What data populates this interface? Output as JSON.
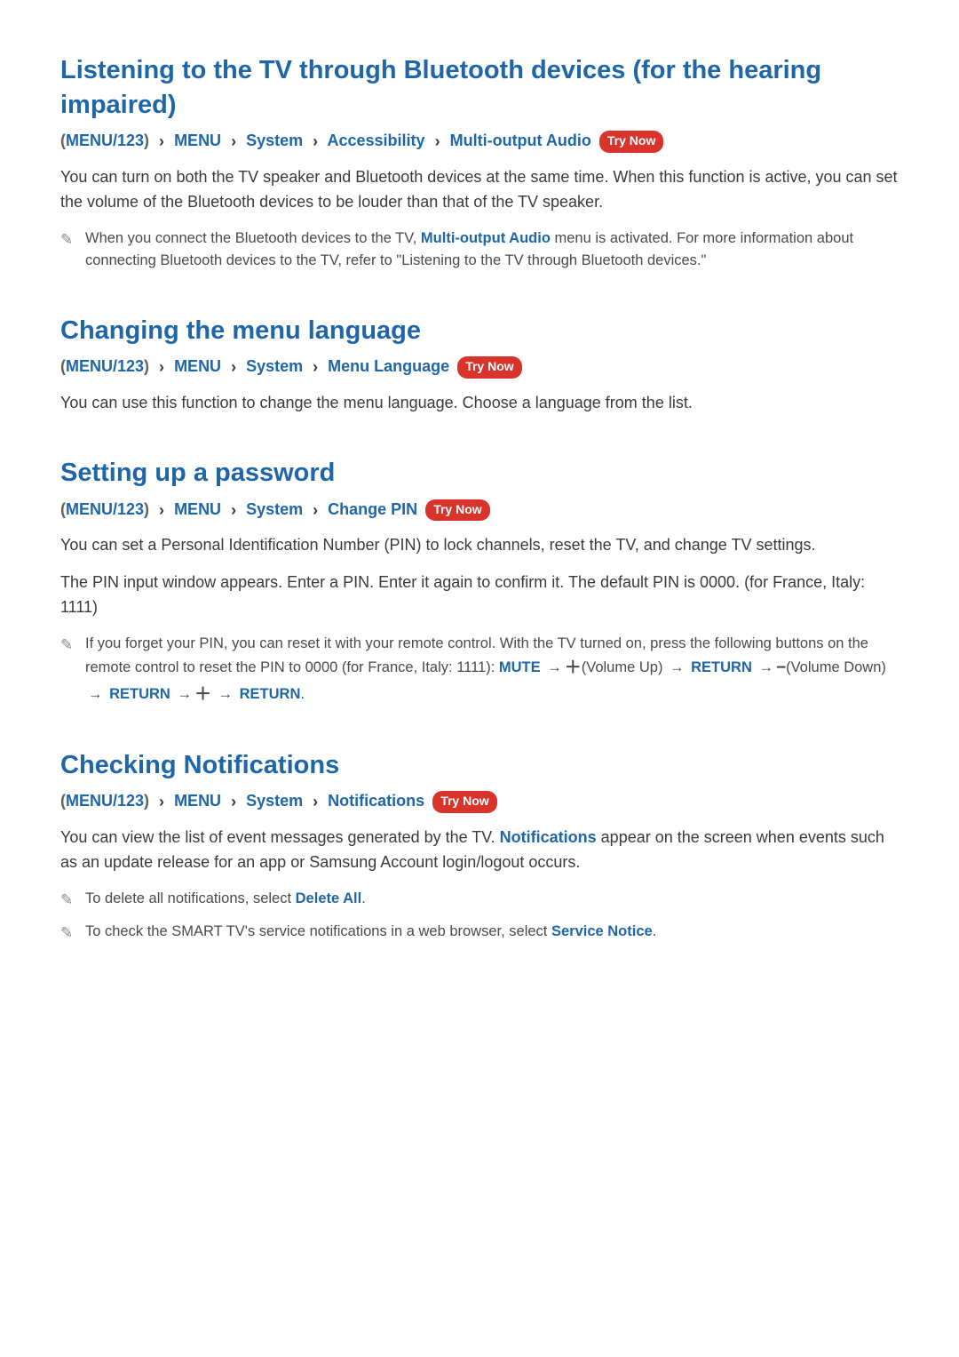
{
  "labels": {
    "try_now": "Try Now",
    "menu123": "MENU/123",
    "chevron": "›"
  },
  "s1": {
    "title": "Listening to the TV through Bluetooth devices (for the hearing impaired)",
    "crumbs": [
      "MENU",
      "System",
      "Accessibility",
      "Multi-output Audio"
    ],
    "p1": "You can turn on both the TV speaker and Bluetooth devices at the same time. When this function is active, you can set the volume of the Bluetooth devices to be louder than that of the TV speaker.",
    "note1_a": "When you connect the Bluetooth devices to the TV, ",
    "note1_hl": "Multi-output Audio",
    "note1_b": " menu is activated. For more information about connecting Bluetooth devices to the TV, refer to \"Listening to the TV through Bluetooth devices.\""
  },
  "s2": {
    "title": "Changing the menu language",
    "crumbs": [
      "MENU",
      "System",
      "Menu Language"
    ],
    "p1": "You can use this function to change the menu language. Choose a language from the list."
  },
  "s3": {
    "title": "Setting up a password",
    "crumbs": [
      "MENU",
      "System",
      "Change PIN"
    ],
    "p1": "You can set a Personal Identification Number (PIN) to lock channels, reset the TV, and change TV settings.",
    "p2": "The PIN input window appears. Enter a PIN. Enter it again to confirm it. The default PIN is 0000. (for France, Italy: 1111)",
    "note1_a": "If you forget your PIN, you can reset it with your remote control. With the TV turned on, press the following buttons on the remote control to reset the PIN to 0000 (for France, Italy: 1111): ",
    "mute": "MUTE",
    "volup": "(Volume Up)",
    "return": "RETURN",
    "voldown": "(Volume Down)"
  },
  "s4": {
    "title": "Checking Notifications",
    "crumbs": [
      "MENU",
      "System",
      "Notifications"
    ],
    "p1_a": "You can view the list of event messages generated by the TV. ",
    "p1_hl": "Notifications",
    "p1_b": " appear on the screen when events such as an update release for an app or Samsung Account login/logout occurs.",
    "note1_a": "To delete all notifications, select ",
    "note1_hl": "Delete All",
    "note2_a": "To check the SMART TV's service notifications in a web browser, select ",
    "note2_hl": "Service Notice"
  }
}
